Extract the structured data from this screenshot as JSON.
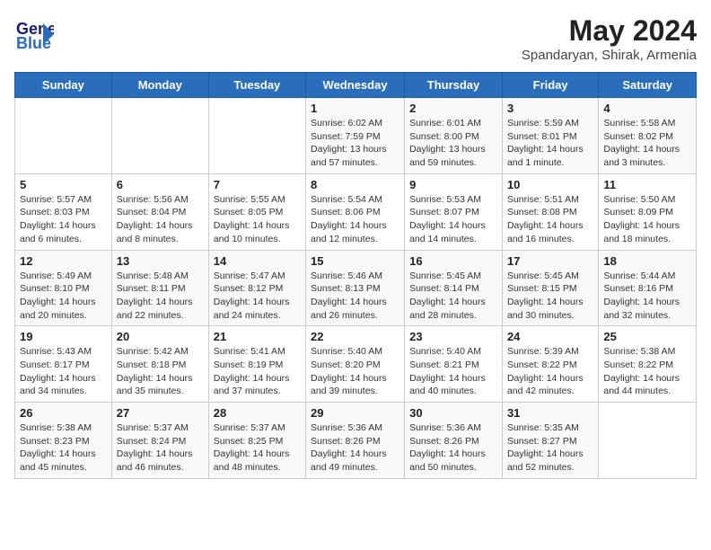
{
  "header": {
    "logo_line1": "General",
    "logo_line2": "Blue",
    "month_title": "May 2024",
    "location": "Spandaryan, Shirak, Armenia"
  },
  "days_of_week": [
    "Sunday",
    "Monday",
    "Tuesday",
    "Wednesday",
    "Thursday",
    "Friday",
    "Saturday"
  ],
  "weeks": [
    [
      {
        "day": "",
        "info": ""
      },
      {
        "day": "",
        "info": ""
      },
      {
        "day": "",
        "info": ""
      },
      {
        "day": "1",
        "info": "Sunrise: 6:02 AM\nSunset: 7:59 PM\nDaylight: 13 hours\nand 57 minutes."
      },
      {
        "day": "2",
        "info": "Sunrise: 6:01 AM\nSunset: 8:00 PM\nDaylight: 13 hours\nand 59 minutes."
      },
      {
        "day": "3",
        "info": "Sunrise: 5:59 AM\nSunset: 8:01 PM\nDaylight: 14 hours\nand 1 minute."
      },
      {
        "day": "4",
        "info": "Sunrise: 5:58 AM\nSunset: 8:02 PM\nDaylight: 14 hours\nand 3 minutes."
      }
    ],
    [
      {
        "day": "5",
        "info": "Sunrise: 5:57 AM\nSunset: 8:03 PM\nDaylight: 14 hours\nand 6 minutes."
      },
      {
        "day": "6",
        "info": "Sunrise: 5:56 AM\nSunset: 8:04 PM\nDaylight: 14 hours\nand 8 minutes."
      },
      {
        "day": "7",
        "info": "Sunrise: 5:55 AM\nSunset: 8:05 PM\nDaylight: 14 hours\nand 10 minutes."
      },
      {
        "day": "8",
        "info": "Sunrise: 5:54 AM\nSunset: 8:06 PM\nDaylight: 14 hours\nand 12 minutes."
      },
      {
        "day": "9",
        "info": "Sunrise: 5:53 AM\nSunset: 8:07 PM\nDaylight: 14 hours\nand 14 minutes."
      },
      {
        "day": "10",
        "info": "Sunrise: 5:51 AM\nSunset: 8:08 PM\nDaylight: 14 hours\nand 16 minutes."
      },
      {
        "day": "11",
        "info": "Sunrise: 5:50 AM\nSunset: 8:09 PM\nDaylight: 14 hours\nand 18 minutes."
      }
    ],
    [
      {
        "day": "12",
        "info": "Sunrise: 5:49 AM\nSunset: 8:10 PM\nDaylight: 14 hours\nand 20 minutes."
      },
      {
        "day": "13",
        "info": "Sunrise: 5:48 AM\nSunset: 8:11 PM\nDaylight: 14 hours\nand 22 minutes."
      },
      {
        "day": "14",
        "info": "Sunrise: 5:47 AM\nSunset: 8:12 PM\nDaylight: 14 hours\nand 24 minutes."
      },
      {
        "day": "15",
        "info": "Sunrise: 5:46 AM\nSunset: 8:13 PM\nDaylight: 14 hours\nand 26 minutes."
      },
      {
        "day": "16",
        "info": "Sunrise: 5:45 AM\nSunset: 8:14 PM\nDaylight: 14 hours\nand 28 minutes."
      },
      {
        "day": "17",
        "info": "Sunrise: 5:45 AM\nSunset: 8:15 PM\nDaylight: 14 hours\nand 30 minutes."
      },
      {
        "day": "18",
        "info": "Sunrise: 5:44 AM\nSunset: 8:16 PM\nDaylight: 14 hours\nand 32 minutes."
      }
    ],
    [
      {
        "day": "19",
        "info": "Sunrise: 5:43 AM\nSunset: 8:17 PM\nDaylight: 14 hours\nand 34 minutes."
      },
      {
        "day": "20",
        "info": "Sunrise: 5:42 AM\nSunset: 8:18 PM\nDaylight: 14 hours\nand 35 minutes."
      },
      {
        "day": "21",
        "info": "Sunrise: 5:41 AM\nSunset: 8:19 PM\nDaylight: 14 hours\nand 37 minutes."
      },
      {
        "day": "22",
        "info": "Sunrise: 5:40 AM\nSunset: 8:20 PM\nDaylight: 14 hours\nand 39 minutes."
      },
      {
        "day": "23",
        "info": "Sunrise: 5:40 AM\nSunset: 8:21 PM\nDaylight: 14 hours\nand 40 minutes."
      },
      {
        "day": "24",
        "info": "Sunrise: 5:39 AM\nSunset: 8:22 PM\nDaylight: 14 hours\nand 42 minutes."
      },
      {
        "day": "25",
        "info": "Sunrise: 5:38 AM\nSunset: 8:22 PM\nDaylight: 14 hours\nand 44 minutes."
      }
    ],
    [
      {
        "day": "26",
        "info": "Sunrise: 5:38 AM\nSunset: 8:23 PM\nDaylight: 14 hours\nand 45 minutes."
      },
      {
        "day": "27",
        "info": "Sunrise: 5:37 AM\nSunset: 8:24 PM\nDaylight: 14 hours\nand 46 minutes."
      },
      {
        "day": "28",
        "info": "Sunrise: 5:37 AM\nSunset: 8:25 PM\nDaylight: 14 hours\nand 48 minutes."
      },
      {
        "day": "29",
        "info": "Sunrise: 5:36 AM\nSunset: 8:26 PM\nDaylight: 14 hours\nand 49 minutes."
      },
      {
        "day": "30",
        "info": "Sunrise: 5:36 AM\nSunset: 8:26 PM\nDaylight: 14 hours\nand 50 minutes."
      },
      {
        "day": "31",
        "info": "Sunrise: 5:35 AM\nSunset: 8:27 PM\nDaylight: 14 hours\nand 52 minutes."
      },
      {
        "day": "",
        "info": ""
      }
    ]
  ]
}
